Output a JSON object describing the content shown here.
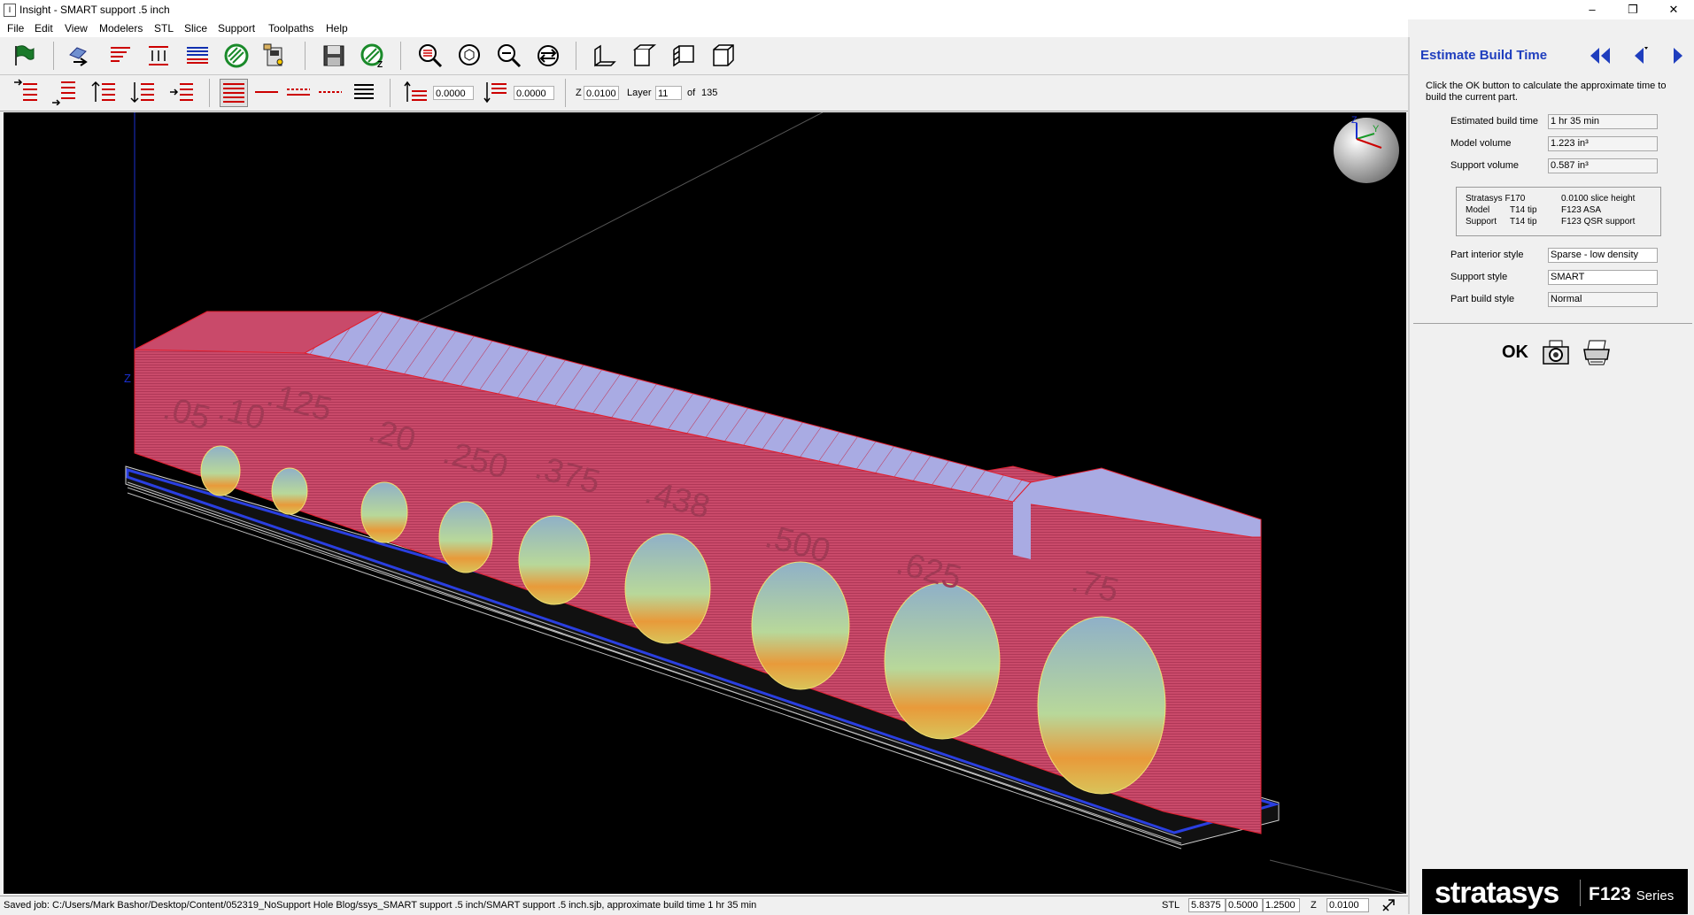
{
  "window": {
    "title": "Insight - SMART support .5 inch",
    "icon_letter": "I"
  },
  "menu": [
    "File",
    "Edit",
    "View",
    "Modelers",
    "STL",
    "Slice",
    "Support",
    "Toolpaths",
    "Help"
  ],
  "toolbar2": {
    "offset1": "0.0000",
    "offset2": "0.0000",
    "z_label": "Z",
    "z_value": "0.0100",
    "layer_label": "Layer",
    "layer_value": "11",
    "of_label": "of",
    "of_value": "135"
  },
  "viewport": {
    "axis_label": "Z",
    "part_labels": [
      ".05",
      ".10",
      ".125",
      ".20",
      ".250",
      ".375",
      ".438",
      ".500",
      ".625",
      ".75"
    ],
    "colors": {
      "part": "#c94a6a",
      "top": "#a9abe3",
      "background": "#000000"
    }
  },
  "panel": {
    "title": "Estimate Build Time",
    "description": "Click the OK button to calculate the approximate time to build the current part.",
    "estimated_label": "Estimated build time",
    "estimated_value": "1 hr 35 min",
    "model_volume_label": "Model volume",
    "model_volume_value": "1.223 in³",
    "support_volume_label": "Support volume",
    "support_volume_value": "0.587 in³",
    "info": {
      "printer": "Stratasys F170",
      "slice": "0.0100 slice height",
      "model_label": "Model",
      "model_tip": "T14 tip",
      "model_material": "F123 ASA",
      "support_label": "Support",
      "support_tip": "T14 tip",
      "support_material": "F123 QSR support"
    },
    "interior_label": "Part interior style",
    "interior_value": "Sparse - low density",
    "support_style_label": "Support style",
    "support_style_value": "SMART",
    "build_style_label": "Part build style",
    "build_style_value": "Normal",
    "ok_label": "OK"
  },
  "brand": {
    "name": "stratasys",
    "series_model": "F123",
    "series_word": "Series"
  },
  "status": {
    "message": "Saved job:  C:/Users/Mark Bashor/Desktop/Content/052319_NoSupport Hole Blog/ssys_SMART support .5 inch/SMART support .5 inch.sjb,  approximate build time 1 hr 35 min",
    "stl_label": "STL",
    "dim_x": "5.8375",
    "dim_y": "0.5000",
    "dim_z": "1.2500",
    "z_label": "Z",
    "z_value": "0.0100"
  }
}
